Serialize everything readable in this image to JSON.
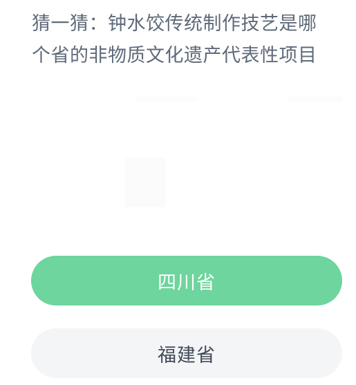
{
  "question": {
    "line1": "猜一猜：钟水饺传统制作技艺是哪",
    "line2": "个省的非物质文化遗产代表性项目"
  },
  "options": [
    {
      "label": "四川省",
      "selected": true,
      "color": "#6dd59d"
    },
    {
      "label": "福建省",
      "selected": false,
      "color": "#f4f5f7"
    }
  ]
}
